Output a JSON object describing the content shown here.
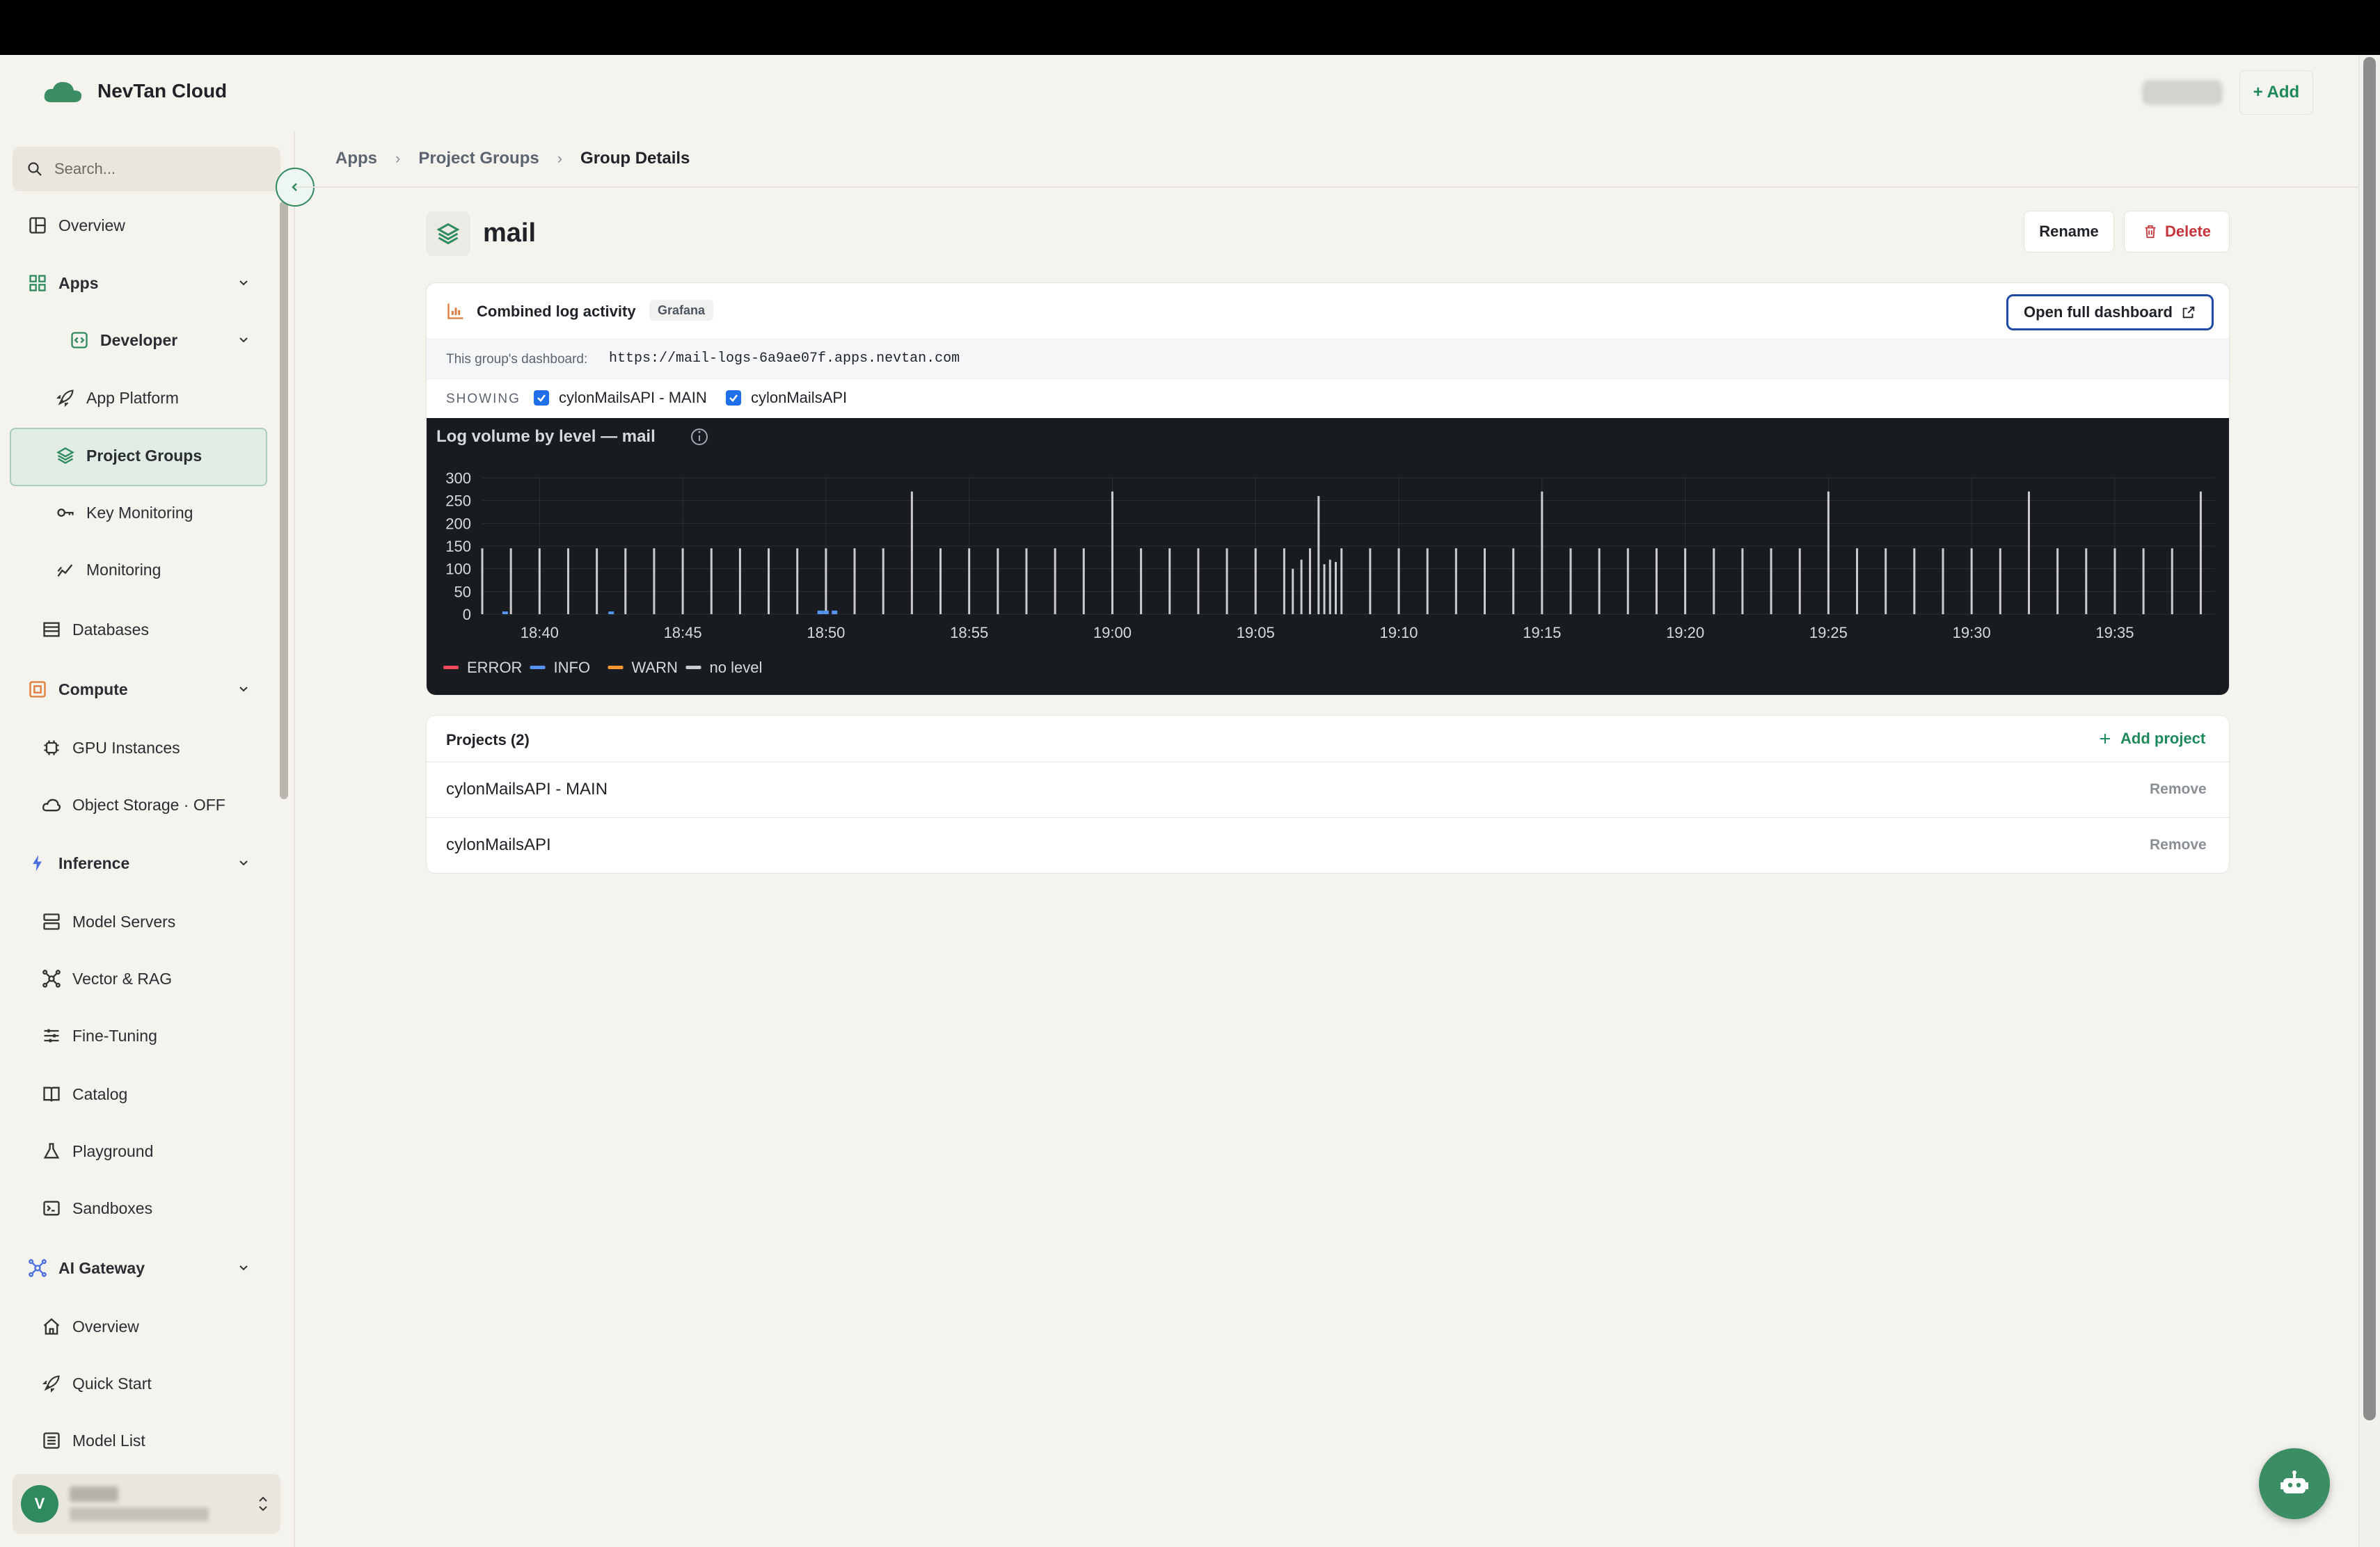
{
  "app": {
    "name": "NevTan Cloud"
  },
  "header": {
    "add_label": "+ Add"
  },
  "search": {
    "placeholder": "Search..."
  },
  "sidebar": {
    "overview": "Overview",
    "apps": "Apps",
    "developer": "Developer",
    "app_platform": "App Platform",
    "project_groups": "Project Groups",
    "key_monitoring": "Key Monitoring",
    "monitoring": "Monitoring",
    "databases": "Databases",
    "compute": "Compute",
    "gpu_instances": "GPU Instances",
    "object_storage": "Object Storage · OFF",
    "inference": "Inference",
    "model_servers": "Model Servers",
    "vector_rag": "Vector & RAG",
    "fine_tuning": "Fine-Tuning",
    "catalog": "Catalog",
    "playground": "Playground",
    "sandboxes": "Sandboxes",
    "ai_gateway": "AI Gateway",
    "gw_overview": "Overview",
    "quick_start": "Quick Start",
    "model_list": "Model List",
    "user_initial": "V"
  },
  "breadcrumb": [
    "Apps",
    "Project Groups",
    "Group Details"
  ],
  "page": {
    "title": "mail",
    "rename": "Rename",
    "delete": "Delete"
  },
  "log_card": {
    "title": "Combined log activity",
    "badge": "Grafana",
    "open_dashboard": "Open full dashboard",
    "dashboard_label": "This group's dashboard:",
    "dashboard_url": "https://mail-logs-6a9ae07f.apps.nevtan.com",
    "showing_label": "SHOWING",
    "checkboxes": [
      "cylonMailsAPI - MAIN",
      "cylonMailsAPI"
    ]
  },
  "chart_data": {
    "type": "bar",
    "title": "Log volume by level — mail",
    "ylim": [
      0,
      300
    ],
    "y_ticks": [
      0,
      50,
      100,
      150,
      200,
      250,
      300
    ],
    "x_ticks": [
      "18:40",
      "18:45",
      "18:50",
      "18:55",
      "19:00",
      "19:05",
      "19:10",
      "19:15",
      "19:20",
      "19:25",
      "19:30",
      "19:35"
    ],
    "x_range_minutes": [
      18.0,
      78.5
    ],
    "legend": [
      {
        "name": "ERROR",
        "color": "#f2495c"
      },
      {
        "name": "INFO",
        "color": "#5794f2"
      },
      {
        "name": "WARN",
        "color": "#ff9830"
      },
      {
        "name": "no level",
        "color": "#cccccc"
      }
    ],
    "series": [
      {
        "name": "no level",
        "color": "#cccccc",
        "x_minutes": [
          18.0,
          19.0,
          20.0,
          21.0,
          22.0,
          23.0,
          24.0,
          25.0,
          26.0,
          27.0,
          28.0,
          29.0,
          30.0,
          31.0,
          32.0,
          33.0,
          34.0,
          35.0,
          36.0,
          37.0,
          38.0,
          39.0,
          40.0,
          41.0,
          42.0,
          43.0,
          44.0,
          45.0,
          46.0,
          46.3,
          46.6,
          46.9,
          47.2,
          47.4,
          47.6,
          47.8,
          48.0,
          49.0,
          50.0,
          51.0,
          52.0,
          53.0,
          54.0,
          55.0,
          56.0,
          57.0,
          58.0,
          59.0,
          60.0,
          61.0,
          62.0,
          63.0,
          64.0,
          65.0,
          66.0,
          67.0,
          68.0,
          69.0,
          70.0,
          71.0,
          72.0,
          73.0,
          74.0,
          75.0,
          76.0,
          77.0,
          78.0
        ],
        "values": [
          145,
          145,
          145,
          145,
          145,
          145,
          145,
          145,
          145,
          145,
          145,
          145,
          145,
          145,
          145,
          270,
          145,
          145,
          145,
          145,
          145,
          145,
          270,
          145,
          145,
          145,
          145,
          145,
          145,
          100,
          120,
          145,
          260,
          110,
          120,
          115,
          145,
          145,
          145,
          145,
          145,
          145,
          145,
          270,
          145,
          145,
          145,
          145,
          145,
          145,
          145,
          145,
          145,
          270,
          145,
          145,
          145,
          145,
          145,
          145,
          270,
          145,
          145,
          145,
          145,
          145,
          270
        ]
      },
      {
        "name": "INFO",
        "color": "#5794f2",
        "x_minutes": [
          18.8,
          22.5,
          29.8,
          30.0,
          30.3
        ],
        "values": [
          6,
          6,
          8,
          8,
          8
        ]
      }
    ]
  },
  "projects": {
    "title": "Projects (2)",
    "add_label": "Add project",
    "remove_label": "Remove",
    "items": [
      "cylonMailsAPI - MAIN",
      "cylonMailsAPI"
    ]
  }
}
